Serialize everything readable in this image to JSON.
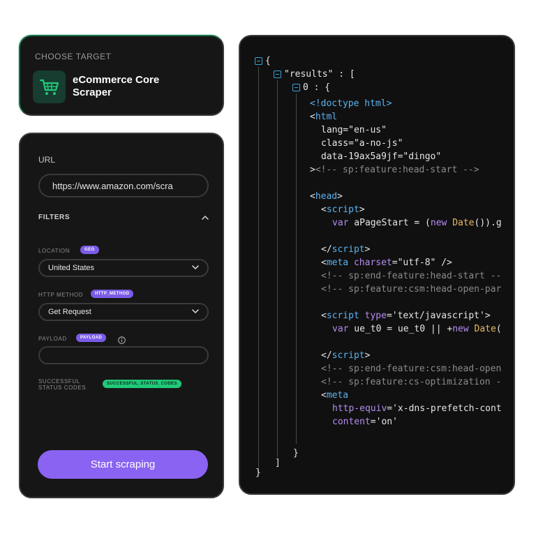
{
  "target": {
    "label": "CHOOSE TARGET",
    "name": "eCommerce Core Scraper",
    "icon": "cart-icon"
  },
  "form": {
    "url_label": "URL",
    "url_value": "https://www.amazon.com/scra",
    "filters_label": "FILTERS",
    "location_label": "LOCATION",
    "location_badge": "GEO",
    "location_value": "United States",
    "http_method_label": "HTTP METHOD",
    "http_method_badge": "HTTP_METHOD",
    "http_method_value": "Get Request",
    "payload_label": "PAYLOAD",
    "payload_badge": "PAYLOAD",
    "payload_value": "",
    "status_codes_label": "SUCCESSFUL STATUS CODES",
    "status_codes_badge": "SUCCESSFUL_STATUS_CODES",
    "start_button": "Start scraping"
  },
  "code": {
    "l1": "{",
    "l2_key": "\"results\"",
    "l2_rest": " : [",
    "l3": "0 : {",
    "l4": "<!doctype html>",
    "l5_lt": "<",
    "l5_tag": "html",
    "l6": "lang=\"en-us\"",
    "l7": "class=\"a-no-js\"",
    "l8": "data-19ax5a9jf=\"dingo\"",
    "l9_gt": ">",
    "l9_cm": "<!-- sp:feature:head-start -->",
    "l10_lt": "<",
    "l10_tag": "head",
    "l10_gt": ">",
    "l11_lt": "<",
    "l11_tag": "script",
    "l11_gt": ">",
    "l12_kw": "var",
    "l12_a": " aPageStart = (",
    "l12_new": "new",
    "l12_sp": " ",
    "l12_fn": "Date",
    "l12_b": "()).g",
    "l13_a": "</",
    "l13_tag": "script",
    "l13_gt": ">",
    "l14_lt": "<",
    "l14_tag": "meta",
    "l14_sp": " ",
    "l14_attr": "charset",
    "l14_rest": "=\"utf-8\" />",
    "l15": "<!-- sp:end-feature:head-start --",
    "l16": "<!-- sp:feature:csm:head-open-par",
    "l17_lt": "<",
    "l17_tag": "script",
    "l17_sp": " ",
    "l17_attr": "type",
    "l17_rest": "='text/javascript'>",
    "l18_kw": "var",
    "l18_a": " ue_t0 = ue_t0 || +",
    "l18_new": "new",
    "l18_sp": " ",
    "l18_fn": "Date",
    "l18_b": "(",
    "l19_a": "</",
    "l19_tag": "script",
    "l19_gt": ">",
    "l20": "<!-- sp:end-feature:csm:head-open",
    "l21": "<!-- sp:feature:cs-optimization -",
    "l22_lt": "<",
    "l22_tag": "meta",
    "l23_attr": "http-equiv",
    "l23_rest": "='x-dns-prefetch-cont",
    "l24_attr": "content",
    "l24_rest": "='on'",
    "l25": "}",
    "l26": "]",
    "l27": "}"
  }
}
